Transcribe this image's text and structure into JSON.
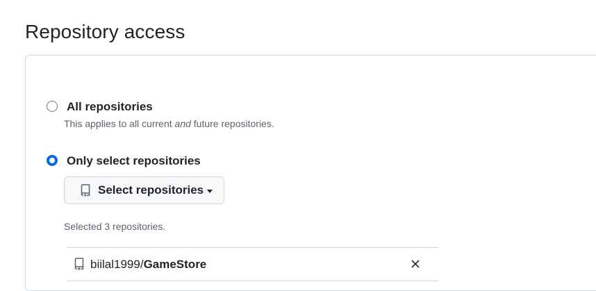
{
  "heading": "Repository access",
  "options": {
    "all": {
      "label": "All repositories",
      "note_before": "This applies to all current ",
      "note_emph": "and",
      "note_after": " future repositories.",
      "selected": false
    },
    "select": {
      "label": "Only select repositories",
      "selected": true
    }
  },
  "select_button": {
    "label": "Select repositories",
    "icon": "repo-icon"
  },
  "selected_count_text": "Selected 3 repositories.",
  "repositories": [
    {
      "owner": "biilal1999/",
      "name": "GameStore",
      "icon": "repo-icon",
      "remove_icon": "close-icon"
    }
  ],
  "colors": {
    "accent": "#0969da",
    "border": "#d0d7de",
    "muted_text": "#59636e",
    "button_bg": "#f6f8fa"
  }
}
